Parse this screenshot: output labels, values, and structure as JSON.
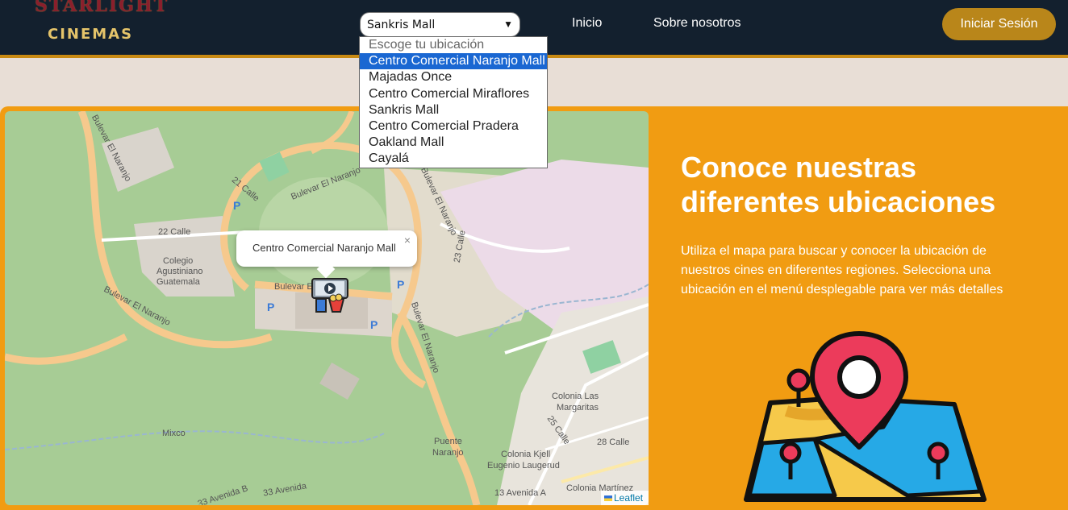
{
  "header": {
    "logo_line1": "STARLIGHT",
    "logo_line2": "CINEMAS",
    "location_select_value": "Sankris Mall",
    "nav": [
      "Inicio",
      "Sobre nosotros"
    ],
    "login_label": "Iniciar Sesión"
  },
  "dropdown": {
    "placeholder": "Escoge tu ubicación",
    "options": [
      "Centro Comercial Naranjo Mall",
      "Majadas Once",
      "Centro Comercial Miraflores",
      "Sankris Mall",
      "Centro Comercial Pradera",
      "Oakland Mall",
      "Cayalá"
    ],
    "highlighted": "Centro Comercial Naranjo Mall"
  },
  "map": {
    "popup_text": "Centro Comercial Naranjo Mall",
    "popup_close": "×",
    "attribution": "Leaflet",
    "labels": [
      "Bulevar El Naranjo",
      "Bulevar El Naranjo",
      "Bulevar El Naranjo",
      "Bulevar El Naranjo",
      "Bulevar El",
      "Bulevar El Naranjo",
      "21 Calle",
      "22 Calle",
      "23 Calle",
      "Colegio",
      "Agustiniano",
      "Guatemala",
      "Colonia Las",
      "Margaritas",
      "Puente",
      "Naranjo",
      "Colonia Kjell",
      "Eugenio Laugerud",
      "Colonia Martínez",
      "28 Calle",
      "25 Calle",
      "33 Avenida",
      "33 Avenida B",
      "13 Avenida A",
      "Mixco",
      "P"
    ]
  },
  "info": {
    "title": "Conoce nuestras diferentes ubicaciones",
    "body": "Utiliza el mapa para buscar y conocer la ubicación de nuestros cines en diferentes regiones. Selecciona una ubicación en el menú desplegable para ver más detalles"
  },
  "colors": {
    "header_bg": "#13202e",
    "accent": "#f19c12",
    "button": "#b9861a",
    "map_green": "#a7cc95",
    "road": "#f6c98d"
  },
  "icons": [
    "chevron-down-icon",
    "cinema-marker-icon",
    "close-icon",
    "location-pin-illustration",
    "leaflet-flag-icon"
  ]
}
